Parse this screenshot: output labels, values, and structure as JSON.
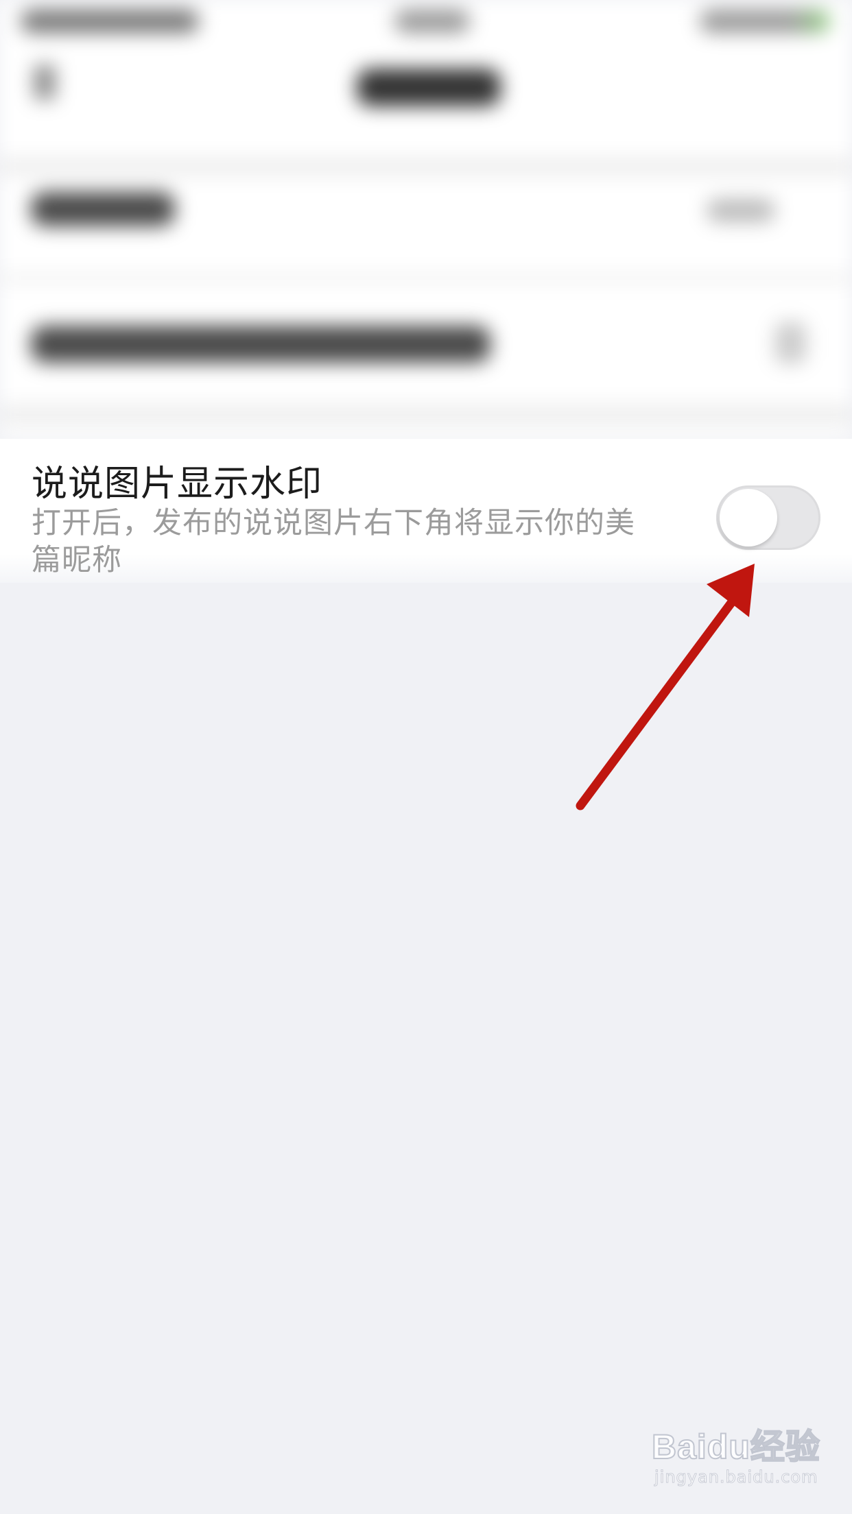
{
  "setting": {
    "title": "说说图片显示水印",
    "description": "打开后，发布的说说图片右下角将显示你的美篇昵称",
    "toggle_on": false
  },
  "watermark": {
    "logo": "Baidu经验",
    "url": "jingyan.baidu.com"
  },
  "colors": {
    "background": "#f0f1f5",
    "title_text": "#1c1c1c",
    "desc_text": "#9b9b9b",
    "toggle_off": "#e6e6e8",
    "arrow": "#c0160f"
  }
}
